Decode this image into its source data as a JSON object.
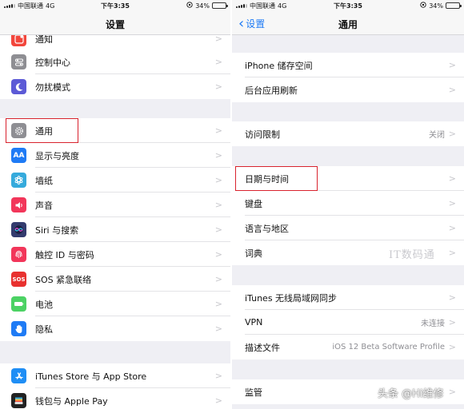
{
  "status": {
    "carrier": "中国联通",
    "network": "4G",
    "time": "下午3:35",
    "battery": "34%",
    "battery_level": 0.34
  },
  "left": {
    "title": "设置",
    "rows": [
      {
        "label": "通知",
        "icon": "notification-icon",
        "color": "#f2463c"
      },
      {
        "label": "控制中心",
        "icon": "control-center-icon",
        "color": "#8e8e93"
      },
      {
        "label": "勿扰模式",
        "icon": "moon-icon",
        "color": "#5c5ad6"
      },
      {
        "label": "通用",
        "icon": "gear-icon",
        "color": "#8e8e93"
      },
      {
        "label": "显示与亮度",
        "icon": "display-brightness-icon",
        "color": "#1f7bf5",
        "glyph": "AA"
      },
      {
        "label": "墙纸",
        "icon": "wallpaper-icon",
        "color": "#35aadc"
      },
      {
        "label": "声音",
        "icon": "speaker-icon",
        "color": "#f2365a"
      },
      {
        "label": "Siri 与搜索",
        "icon": "siri-icon",
        "color": "#333b6e"
      },
      {
        "label": "触控 ID 与密码",
        "icon": "fingerprint-icon",
        "color": "#f2365a"
      },
      {
        "label": "SOS 紧急联络",
        "icon": "sos-icon",
        "color": "#e8312f",
        "glyph": "SOS"
      },
      {
        "label": "电池",
        "icon": "battery-icon",
        "color": "#4cd264"
      },
      {
        "label": "隐私",
        "icon": "hand-icon",
        "color": "#1f7bf5"
      },
      {
        "label": "iTunes Store 与 App Store",
        "icon": "app-store-icon",
        "color": "#1f8ef5"
      },
      {
        "label": "钱包与 Apple Pay",
        "icon": "wallet-icon",
        "color": "#222222"
      }
    ]
  },
  "right": {
    "back_label": "设置",
    "title": "通用",
    "rows": [
      {
        "label": "iPhone 储存空间",
        "value": ""
      },
      {
        "label": "后台应用刷新",
        "value": ""
      },
      {
        "label": "访问限制",
        "value": "关闭"
      },
      {
        "label": "日期与时间",
        "value": ""
      },
      {
        "label": "键盘",
        "value": ""
      },
      {
        "label": "语言与地区",
        "value": ""
      },
      {
        "label": "词典",
        "value": ""
      },
      {
        "label": "iTunes 无线局域网同步",
        "value": ""
      },
      {
        "label": "VPN",
        "value": "未连接"
      },
      {
        "label": "描述文件",
        "value": "iOS 12 Beta Software Profile"
      },
      {
        "label": "监管",
        "value": ""
      }
    ]
  },
  "watermarks": {
    "it": "IT数码通",
    "brand": "头条 @Hi维修"
  },
  "colors": {
    "accent": "#1f7bf5",
    "highlight": "#d9232e"
  }
}
